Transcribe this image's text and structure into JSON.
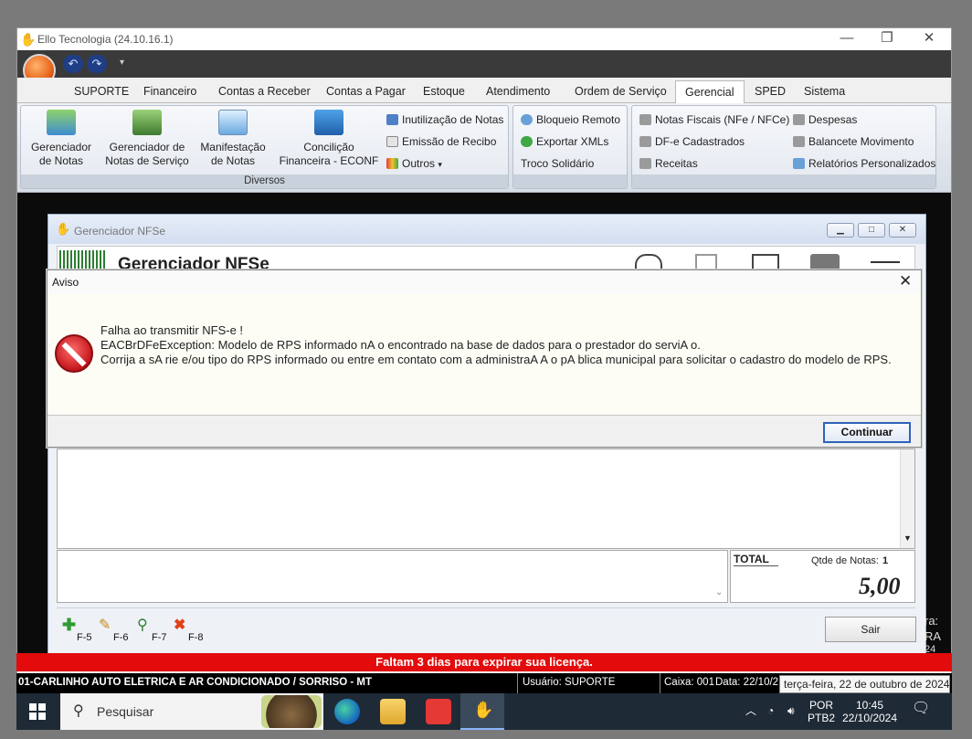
{
  "app": {
    "title": "Ello Tecnologia (24.10.16.1)"
  },
  "ribbon_tabs": [
    "SUPORTE",
    "Financeiro",
    "Contas a Receber",
    "Contas a Pagar",
    "Estoque",
    "Atendimento",
    "Ordem de Serviço",
    "Gerencial",
    "SPED",
    "Sistema"
  ],
  "active_tab": "Gerencial",
  "ribbon": {
    "big_buttons": [
      {
        "line1": "Gerenciador",
        "line2": "de Notas"
      },
      {
        "line1": "Gerenciador de",
        "line2": "Notas de Serviço"
      },
      {
        "line1": "Manifestação",
        "line2": "de Notas"
      },
      {
        "line1": "Concilição",
        "line2": "Financeira - ECONF"
      }
    ],
    "small_col1": [
      "Inutilização de Notas",
      "Emissão de Recibo",
      "Outros"
    ],
    "group1_label": "Diversos",
    "small_col2": [
      "Bloqueio Remoto",
      "Exportar XMLs",
      "Troco Solidário"
    ],
    "small_col3": [
      "Notas Fiscais (NFe / NFCe)",
      "DF-e Cadastrados",
      "Receitas"
    ],
    "small_col4": [
      "Despesas",
      "Balancete Movimento",
      "Relatórios Personalizados"
    ]
  },
  "child": {
    "title": "Gerenciador NFSe",
    "heading": "Gerenciador NFSe",
    "total_label": "TOTAL",
    "qtde_label": "Qtde de Notas:",
    "qtde_value": "1",
    "total_value": "5,00",
    "fkeys": [
      "F-5",
      "F-6",
      "F-7",
      "F-8"
    ],
    "sair": "Sair"
  },
  "dialog": {
    "title": "Aviso",
    "line1": "Falha ao transmitir NFS-e !",
    "line2": "EACBrDFeException: Modelo de RPS informado nA o encontrado na base de dados para o prestador do serviA o.",
    "line3": "Corrija a sA rie e/ou tipo do RPS informado ou entre em contato com a administraA A o pA blica municipal para solicitar o cadastro do modelo de RPS.",
    "button": "Continuar"
  },
  "license_banner": "Faltam 3 dias para expirar sua licença.",
  "statusbar": {
    "company": "01-CARLINHO AUTO ELETRICA E AR CONDICIONADO / SORRISO - MT",
    "user": "Usuário: SUPORTE",
    "caixa": "Caixa: 001",
    "date": "Data: 22/10/2",
    "tooltip": "terça-feira, 22 de outubro de 2024"
  },
  "side_text": [
    "ra:",
    "RA",
    "24"
  ],
  "taskbar": {
    "search_placeholder": "Pesquisar",
    "lang1": "POR",
    "lang2": "PTB2",
    "time": "10:45",
    "date": "22/10/2024"
  },
  "colors": {
    "license_red": "#e30b0b",
    "taskbar": "#1e2a36",
    "accent_blue": "#2f62b8"
  }
}
